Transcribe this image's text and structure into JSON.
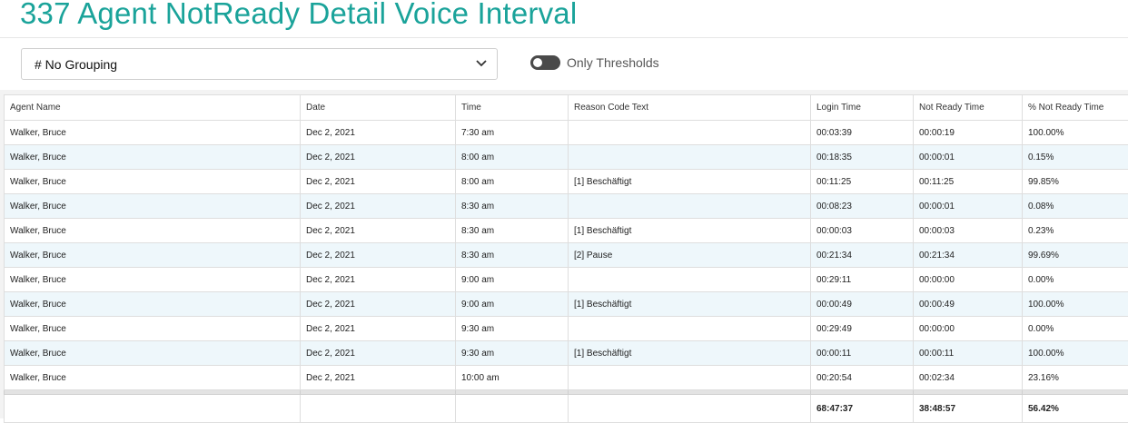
{
  "title": "337 Agent NotReady Detail Voice Interval",
  "grouping": {
    "selected": "# No Grouping"
  },
  "toggle": {
    "label": "Only Thresholds",
    "on": false
  },
  "columns": [
    "Agent Name",
    "Date",
    "Time",
    "Reason Code Text",
    "Login Time",
    "Not Ready Time",
    "% Not Ready Time"
  ],
  "rows": [
    [
      "Walker, Bruce",
      "Dec 2, 2021",
      "7:30 am",
      "",
      "00:03:39",
      "00:00:19",
      "100.00%"
    ],
    [
      "Walker, Bruce",
      "Dec 2, 2021",
      "8:00 am",
      "",
      "00:18:35",
      "00:00:01",
      "0.15%"
    ],
    [
      "Walker, Bruce",
      "Dec 2, 2021",
      "8:00 am",
      "[1] Beschäftigt",
      "00:11:25",
      "00:11:25",
      "99.85%"
    ],
    [
      "Walker, Bruce",
      "Dec 2, 2021",
      "8:30 am",
      "",
      "00:08:23",
      "00:00:01",
      "0.08%"
    ],
    [
      "Walker, Bruce",
      "Dec 2, 2021",
      "8:30 am",
      "[1] Beschäftigt",
      "00:00:03",
      "00:00:03",
      "0.23%"
    ],
    [
      "Walker, Bruce",
      "Dec 2, 2021",
      "8:30 am",
      "[2] Pause",
      "00:21:34",
      "00:21:34",
      "99.69%"
    ],
    [
      "Walker, Bruce",
      "Dec 2, 2021",
      "9:00 am",
      "",
      "00:29:11",
      "00:00:00",
      "0.00%"
    ],
    [
      "Walker, Bruce",
      "Dec 2, 2021",
      "9:00 am",
      "[1] Beschäftigt",
      "00:00:49",
      "00:00:49",
      "100.00%"
    ],
    [
      "Walker, Bruce",
      "Dec 2, 2021",
      "9:30 am",
      "",
      "00:29:49",
      "00:00:00",
      "0.00%"
    ],
    [
      "Walker, Bruce",
      "Dec 2, 2021",
      "9:30 am",
      "[1] Beschäftigt",
      "00:00:11",
      "00:00:11",
      "100.00%"
    ],
    [
      "Walker, Bruce",
      "Dec 2, 2021",
      "10:00 am",
      "",
      "00:20:54",
      "00:02:34",
      "23.16%"
    ]
  ],
  "totals": [
    "",
    "",
    "",
    "",
    "68:47:37",
    "38:48:57",
    "56.42%"
  ]
}
